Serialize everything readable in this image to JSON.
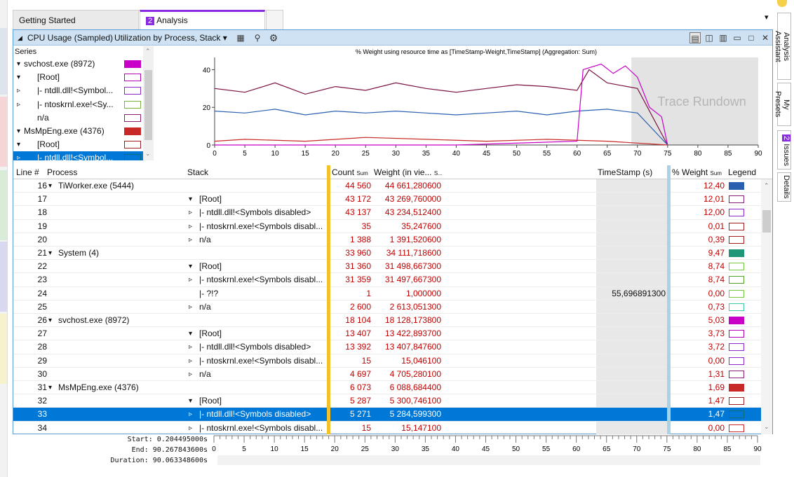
{
  "tabs": [
    {
      "label": "Getting Started"
    },
    {
      "num": "2",
      "label": "Analysis"
    }
  ],
  "panel": {
    "title": "CPU Usage (Sampled)",
    "view": "Utilization by Process, Stack",
    "chart_title": "% Weight using resource time as [TimeStamp-Weight,TimeStamp] (Aggregation: Sum)",
    "watermark": "Trace Rundown"
  },
  "series": {
    "header": "Series",
    "rows": [
      {
        "label": "svchost.exe (8972)",
        "indent": 0,
        "exp": "▾",
        "color": "#c800c8",
        "fill": true
      },
      {
        "label": "[Root]",
        "indent": 1,
        "exp": "▾",
        "color": "#b400b4",
        "fill": false
      },
      {
        "label": "|- ntdll.dll!<Symbol...",
        "indent": 2,
        "exp": "▹",
        "color": "#8c28c8",
        "fill": false
      },
      {
        "label": "|- ntoskrnl.exe!<Sy...",
        "indent": 2,
        "exp": "▹",
        "color": "#78b43c",
        "fill": false
      },
      {
        "label": "n/a",
        "indent": 2,
        "exp": "",
        "color": "#8c1e78",
        "fill": false
      },
      {
        "label": "MsMpEng.exe (4376)",
        "indent": 0,
        "exp": "▾",
        "color": "#c82828",
        "fill": true
      },
      {
        "label": "[Root]",
        "indent": 1,
        "exp": "▾",
        "color": "#a01e1e",
        "fill": false
      },
      {
        "label": "|- ntdll.dll!<Symbol...",
        "indent": 2,
        "exp": "▹",
        "color": "#0f6e78",
        "fill": false,
        "selected": true
      }
    ]
  },
  "chart_data": {
    "type": "line",
    "title": "% Weight using resource time as [TimeStamp-Weight,TimeStamp] (Aggregation: Sum)",
    "xlim": [
      0,
      90
    ],
    "ylim": [
      0,
      45
    ],
    "x_ticks": [
      0,
      5,
      10,
      15,
      20,
      25,
      30,
      35,
      40,
      45,
      50,
      55,
      60,
      65,
      70,
      75,
      80,
      85,
      90
    ],
    "y_ticks": [
      0,
      20,
      40
    ],
    "series": [
      {
        "name": "TiWorker.exe (5444)",
        "color": "#7a1040",
        "x": [
          0,
          5,
          10,
          15,
          20,
          25,
          30,
          35,
          40,
          45,
          50,
          55,
          60,
          62,
          65,
          70,
          75
        ],
        "values": [
          30,
          28,
          33,
          27,
          31,
          29,
          33,
          30,
          28,
          30,
          32,
          31,
          29,
          40,
          33,
          30,
          0
        ]
      },
      {
        "name": "System (4)",
        "color": "#2a5fb0",
        "x": [
          0,
          5,
          10,
          15,
          20,
          25,
          30,
          35,
          40,
          45,
          50,
          55,
          60,
          65,
          70,
          75
        ],
        "values": [
          18,
          17,
          19,
          16,
          18,
          17,
          18,
          17,
          16,
          17,
          18,
          16,
          18,
          19,
          17,
          0
        ]
      },
      {
        "name": "svchost.exe (8972)",
        "color": "#c800c8",
        "x": [
          0,
          20,
          40,
          60,
          61,
          64,
          66,
          68,
          70,
          72,
          74,
          75
        ],
        "values": [
          0,
          0,
          0,
          2,
          40,
          43,
          38,
          42,
          36,
          20,
          15,
          0
        ]
      },
      {
        "name": "MsMpEng.exe (4376)",
        "color": "#c82828",
        "x": [
          0,
          5,
          15,
          25,
          35,
          45,
          55,
          65,
          75
        ],
        "values": [
          2,
          3,
          2,
          4,
          3,
          2,
          3,
          2,
          0
        ]
      }
    ]
  },
  "table": {
    "headers": {
      "line": "Line #",
      "process": "Process",
      "stack": "Stack",
      "count": "Count",
      "count_sub": "Sum",
      "weight": "Weight (in vie...",
      "weight_sub": "S...",
      "timestamp": "TimeStamp (s)",
      "pct": "% Weight",
      "pct_sub": "Sum",
      "legend": "Legend"
    },
    "rows": [
      {
        "line": "16",
        "pexp": "▾",
        "process": "TiWorker.exe (5444)",
        "sexp": "",
        "stack": "",
        "count": "44 560",
        "weight": "44 661,280600",
        "ts": "",
        "pct": "12,40",
        "color": "#2a5fb0",
        "fill": true
      },
      {
        "line": "17",
        "pexp": "",
        "process": "",
        "sexp": "▾",
        "stack": "[Root]",
        "count": "43 172",
        "weight": "43 269,760000",
        "ts": "",
        "pct": "12,01",
        "color": "#8c1e78",
        "fill": false
      },
      {
        "line": "18",
        "pexp": "",
        "process": "",
        "sexp": "▹",
        "stack": "|- ntdll.dll!<Symbols disabled>",
        "count": "43 137",
        "weight": "43 234,512400",
        "ts": "",
        "pct": "12,00",
        "color": "#8c28c8",
        "fill": false
      },
      {
        "line": "19",
        "pexp": "",
        "process": "",
        "sexp": "▹",
        "stack": "|- ntoskrnl.exe!<Symbols disabl...",
        "count": "35",
        "weight": "35,247600",
        "ts": "",
        "pct": "0,01",
        "color": "#a01e1e",
        "fill": false
      },
      {
        "line": "20",
        "pexp": "",
        "process": "",
        "sexp": "▹",
        "stack": "n/a",
        "count": "1 388",
        "weight": "1 391,520600",
        "ts": "",
        "pct": "0,39",
        "color": "#a01e1e",
        "fill": false
      },
      {
        "line": "21",
        "pexp": "▾",
        "process": "System (4)",
        "sexp": "",
        "stack": "",
        "count": "33 960",
        "weight": "34 111,718600",
        "ts": "",
        "pct": "9,47",
        "color": "#1e9678",
        "fill": true
      },
      {
        "line": "22",
        "pexp": "",
        "process": "",
        "sexp": "▾",
        "stack": "[Root]",
        "count": "31 360",
        "weight": "31 498,667300",
        "ts": "",
        "pct": "8,74",
        "color": "#78c83c",
        "fill": false
      },
      {
        "line": "23",
        "pexp": "",
        "process": "",
        "sexp": "▹",
        "stack": "|- ntoskrnl.exe!<Symbols disabl...",
        "count": "31 359",
        "weight": "31 497,667300",
        "ts": "",
        "pct": "8,74",
        "color": "#50a028",
        "fill": false
      },
      {
        "line": "24",
        "pexp": "",
        "process": "",
        "sexp": "",
        "stack": "|- ?!?",
        "count": "1",
        "weight": "1,000000",
        "ts": "55,696891300",
        "pct": "0,00",
        "color": "#78c83c",
        "fill": false
      },
      {
        "line": "25",
        "pexp": "",
        "process": "",
        "sexp": "▹",
        "stack": "n/a",
        "count": "2 600",
        "weight": "2 613,051300",
        "ts": "",
        "pct": "0,73",
        "color": "#3cc8a0",
        "fill": false
      },
      {
        "line": "26",
        "pexp": "▾",
        "process": "svchost.exe (8972)",
        "sexp": "",
        "stack": "",
        "count": "18 104",
        "weight": "18 128,173800",
        "ts": "",
        "pct": "5,03",
        "color": "#c800c8",
        "fill": true
      },
      {
        "line": "27",
        "pexp": "",
        "process": "",
        "sexp": "▾",
        "stack": "[Root]",
        "count": "13 407",
        "weight": "13 422,893700",
        "ts": "",
        "pct": "3,73",
        "color": "#b400b4",
        "fill": false
      },
      {
        "line": "28",
        "pexp": "",
        "process": "",
        "sexp": "▹",
        "stack": "|- ntdll.dll!<Symbols disabled>",
        "count": "13 392",
        "weight": "13 407,847600",
        "ts": "",
        "pct": "3,72",
        "color": "#8c28c8",
        "fill": false
      },
      {
        "line": "29",
        "pexp": "",
        "process": "",
        "sexp": "▹",
        "stack": "|- ntoskrnl.exe!<Symbols disabl...",
        "count": "15",
        "weight": "15,046100",
        "ts": "",
        "pct": "0,00",
        "color": "#8c28c8",
        "fill": false
      },
      {
        "line": "30",
        "pexp": "",
        "process": "",
        "sexp": "▹",
        "stack": "n/a",
        "count": "4 697",
        "weight": "4 705,280100",
        "ts": "",
        "pct": "1,31",
        "color": "#8c1e78",
        "fill": false
      },
      {
        "line": "31",
        "pexp": "▾",
        "process": "MsMpEng.exe (4376)",
        "sexp": "",
        "stack": "",
        "count": "6 073",
        "weight": "6 088,684400",
        "ts": "",
        "pct": "1,69",
        "color": "#c82828",
        "fill": true
      },
      {
        "line": "32",
        "pexp": "",
        "process": "",
        "sexp": "▾",
        "stack": "[Root]",
        "count": "5 287",
        "weight": "5 300,746100",
        "ts": "",
        "pct": "1,47",
        "color": "#a01e1e",
        "fill": false
      },
      {
        "line": "33",
        "pexp": "",
        "process": "",
        "sexp": "▹",
        "stack": "|- ntdll.dll!<Symbols disabled>",
        "count": "5 271",
        "weight": "5 284,599300",
        "ts": "",
        "pct": "1,47",
        "color": "#0f6e78",
        "fill": false,
        "selected": true
      },
      {
        "line": "34",
        "pexp": "",
        "process": "",
        "sexp": "▹",
        "stack": "|- ntoskrnl.exe!<Symbols disabl...",
        "count": "15",
        "weight": "15,147100",
        "ts": "",
        "pct": "0,00",
        "color": "#c82828",
        "fill": false
      }
    ]
  },
  "bottom": {
    "start_label": "Start:",
    "start": "0.204495000s",
    "end_label": "End:",
    "end": "90.267843600s",
    "duration_label": "Duration:",
    "duration": "90.063348600s"
  },
  "right_tabs": [
    {
      "label": "Analysis Assistant"
    },
    {
      "label": "My Presets"
    },
    {
      "num": "2",
      "label": "Issues"
    },
    {
      "label": "Details"
    }
  ],
  "colors": {
    "accent": "#8a2be2",
    "selection": "#0078d7",
    "header": "#cfe2f3"
  }
}
